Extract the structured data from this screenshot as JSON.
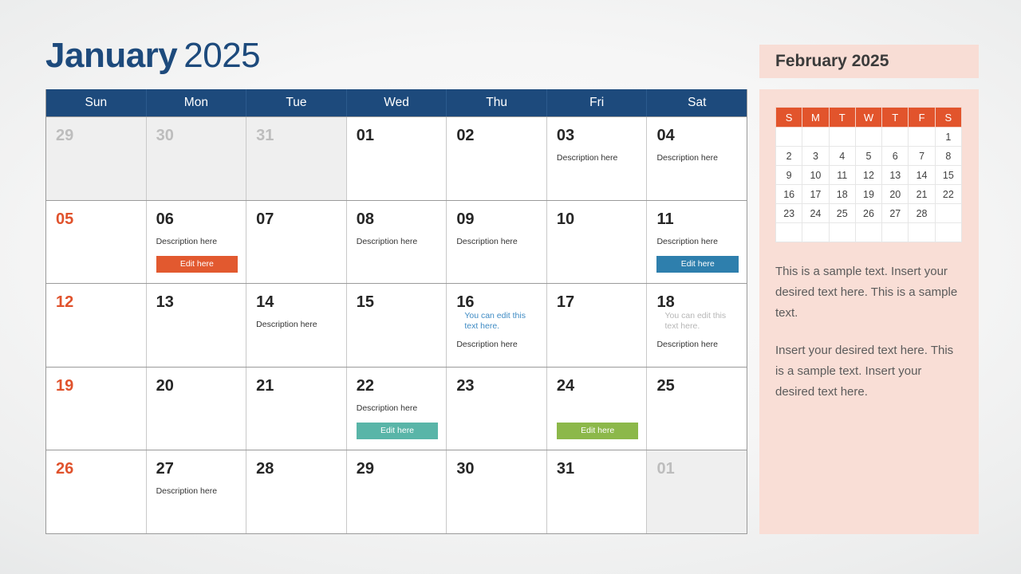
{
  "title": {
    "month": "January",
    "year": "2025"
  },
  "calendar": {
    "weekdays": [
      "Sun",
      "Mon",
      "Tue",
      "Wed",
      "Thu",
      "Fri",
      "Sat"
    ],
    "weeks": [
      [
        {
          "num": "29",
          "out": true
        },
        {
          "num": "30",
          "out": true
        },
        {
          "num": "31",
          "out": true
        },
        {
          "num": "01"
        },
        {
          "num": "02"
        },
        {
          "num": "03",
          "desc": "Description here"
        },
        {
          "num": "04",
          "desc": "Description here"
        }
      ],
      [
        {
          "num": "05",
          "sun": true
        },
        {
          "num": "06",
          "desc": "Description here",
          "button": {
            "label": "Edit here",
            "color": "orange"
          }
        },
        {
          "num": "07"
        },
        {
          "num": "08",
          "desc": "Description here"
        },
        {
          "num": "09",
          "desc": "Description here"
        },
        {
          "num": "10"
        },
        {
          "num": "11",
          "desc": "Description here",
          "button": {
            "label": "Edit here",
            "color": "blue"
          }
        }
      ],
      [
        {
          "num": "12",
          "sun": true
        },
        {
          "num": "13"
        },
        {
          "num": "14",
          "desc": "Description here"
        },
        {
          "num": "15"
        },
        {
          "num": "16",
          "note": "You can edit this text here.",
          "desc": "Description here"
        },
        {
          "num": "17"
        },
        {
          "num": "18",
          "note": "You can edit this text here.",
          "note_grey": true,
          "desc": "Description here"
        }
      ],
      [
        {
          "num": "19",
          "sun": true
        },
        {
          "num": "20"
        },
        {
          "num": "21"
        },
        {
          "num": "22",
          "desc": "Description here",
          "button": {
            "label": "Edit here",
            "color": "teal"
          }
        },
        {
          "num": "23"
        },
        {
          "num": "24",
          "button": {
            "label": "Edit here",
            "color": "green"
          }
        },
        {
          "num": "25"
        }
      ],
      [
        {
          "num": "26",
          "sun": true
        },
        {
          "num": "27",
          "desc": "Description here"
        },
        {
          "num": "28"
        },
        {
          "num": "29"
        },
        {
          "num": "30"
        },
        {
          "num": "31"
        },
        {
          "num": "01",
          "out": true
        }
      ]
    ]
  },
  "sidebar": {
    "title": "February 2025",
    "mini": {
      "weekdays": [
        "S",
        "M",
        "T",
        "W",
        "T",
        "F",
        "S"
      ],
      "weeks": [
        [
          "",
          "",
          "",
          "",
          "",
          "",
          "1"
        ],
        [
          "2",
          "3",
          "4",
          "5",
          "6",
          "7",
          "8"
        ],
        [
          "9",
          "10",
          "11",
          "12",
          "13",
          "14",
          "15"
        ],
        [
          "16",
          "17",
          "18",
          "19",
          "20",
          "21",
          "22"
        ],
        [
          "23",
          "24",
          "25",
          "26",
          "27",
          "28",
          ""
        ],
        [
          "",
          "",
          "",
          "",
          "",
          "",
          ""
        ]
      ]
    },
    "paragraphs": [
      "This is a sample text. Insert your desired text here. This is a sample text.",
      "Insert your desired text here. This is a sample text. Insert your desired text here."
    ]
  },
  "colors": {
    "header_blue": "#1d4a7c",
    "accent_orange": "#e2542c",
    "button_orange": "#e2592f",
    "button_blue": "#2e7fad",
    "button_teal": "#59b5a8",
    "button_green": "#8cb84a",
    "panel_pink": "#f9ded6"
  }
}
